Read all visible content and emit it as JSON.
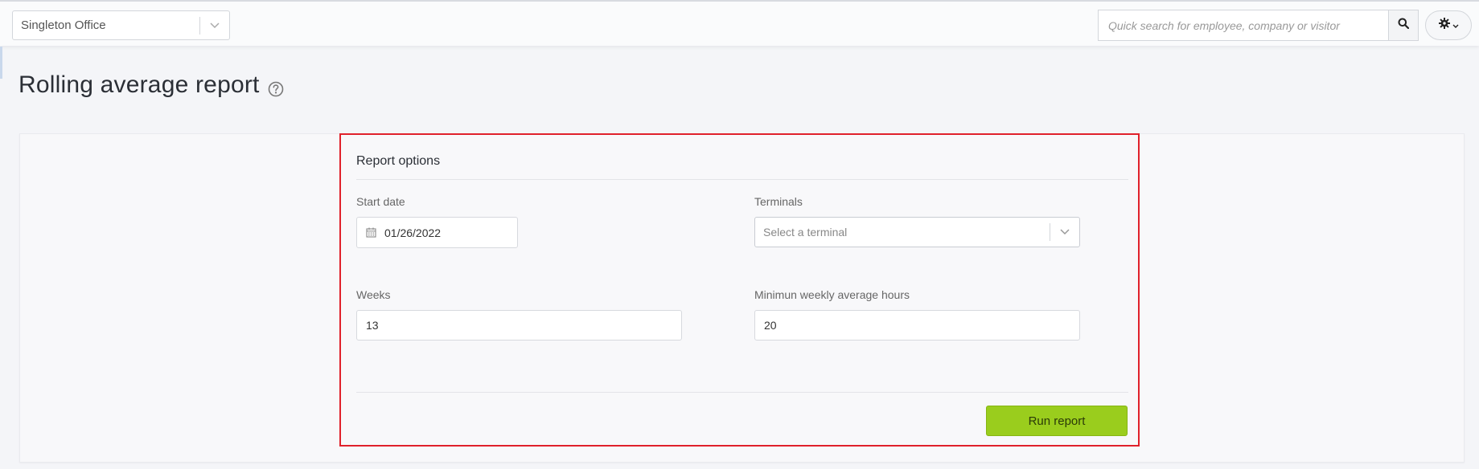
{
  "topbar": {
    "office_select": {
      "value": "Singleton Office"
    },
    "search": {
      "placeholder": "Quick search for employee, company or visitor"
    }
  },
  "page": {
    "title": "Rolling average report"
  },
  "report_options": {
    "title": "Report options",
    "start_date": {
      "label": "Start date",
      "value": "01/26/2022"
    },
    "terminals": {
      "label": "Terminals",
      "placeholder": "Select a terminal"
    },
    "weeks": {
      "label": "Weeks",
      "value": "13"
    },
    "min_hours": {
      "label": "Minimun weekly average hours",
      "value": "20"
    },
    "run_label": "Run report"
  },
  "colors": {
    "accent_green": "#9acd1d",
    "highlight_red": "#e0212b"
  },
  "icons": [
    "chevron-down-icon",
    "search-icon",
    "gear-icon",
    "help-icon",
    "calendar-icon"
  ]
}
